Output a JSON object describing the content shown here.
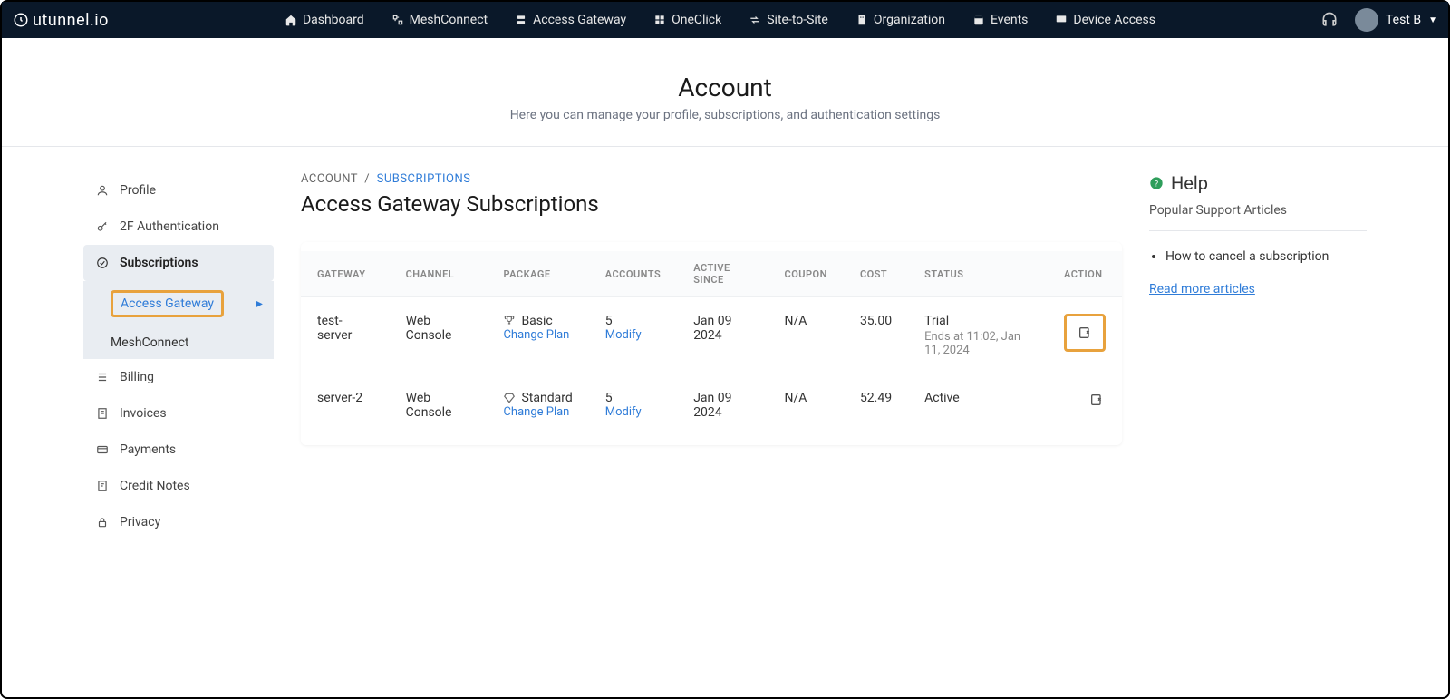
{
  "brand": "utunnel.io",
  "topnav": {
    "items": [
      {
        "label": "Dashboard"
      },
      {
        "label": "MeshConnect"
      },
      {
        "label": "Access Gateway"
      },
      {
        "label": "OneClick"
      },
      {
        "label": "Site-to-Site"
      },
      {
        "label": "Organization"
      },
      {
        "label": "Events"
      },
      {
        "label": "Device Access"
      }
    ],
    "user": "Test B"
  },
  "header": {
    "title": "Account",
    "subtitle": "Here you can manage your profile, subscriptions, and authentication settings"
  },
  "sidebar": {
    "items": {
      "profile": "Profile",
      "twofa": "2F Authentication",
      "subscriptions": "Subscriptions",
      "sub_access_gateway": "Access Gateway",
      "sub_meshconnect": "MeshConnect",
      "billing": "Billing",
      "invoices": "Invoices",
      "payments": "Payments",
      "credit_notes": "Credit Notes",
      "privacy": "Privacy"
    }
  },
  "breadcrumb": {
    "root": "ACCOUNT",
    "sep": "/",
    "current": "SUBSCRIPTIONS"
  },
  "section_title": "Access Gateway Subscriptions",
  "table": {
    "headers": {
      "gateway": "GATEWAY",
      "channel": "CHANNEL",
      "package": "PACKAGE",
      "accounts": "ACCOUNTS",
      "active_since": "ACTIVE SINCE",
      "coupon": "COUPON",
      "cost": "COST",
      "status": "STATUS",
      "action": "ACTION"
    },
    "change_plan_label": "Change Plan",
    "modify_label": "Modify",
    "rows": [
      {
        "gateway": "test-server",
        "channel": "Web Console",
        "package": "Basic",
        "accounts": "5",
        "active_since": "Jan 09 2024",
        "coupon": "N/A",
        "cost": "35.00",
        "status": "Trial",
        "status_sub": "Ends at 11:02, Jan 11, 2024"
      },
      {
        "gateway": "server-2",
        "channel": "Web Console",
        "package": "Standard",
        "accounts": "5",
        "active_since": "Jan 09 2024",
        "coupon": "N/A",
        "cost": "52.49",
        "status": "Active",
        "status_sub": ""
      }
    ]
  },
  "help": {
    "title": "Help",
    "subtitle": "Popular Support Articles",
    "articles": [
      "How to cancel a subscription"
    ],
    "read_more": "Read more articles"
  }
}
